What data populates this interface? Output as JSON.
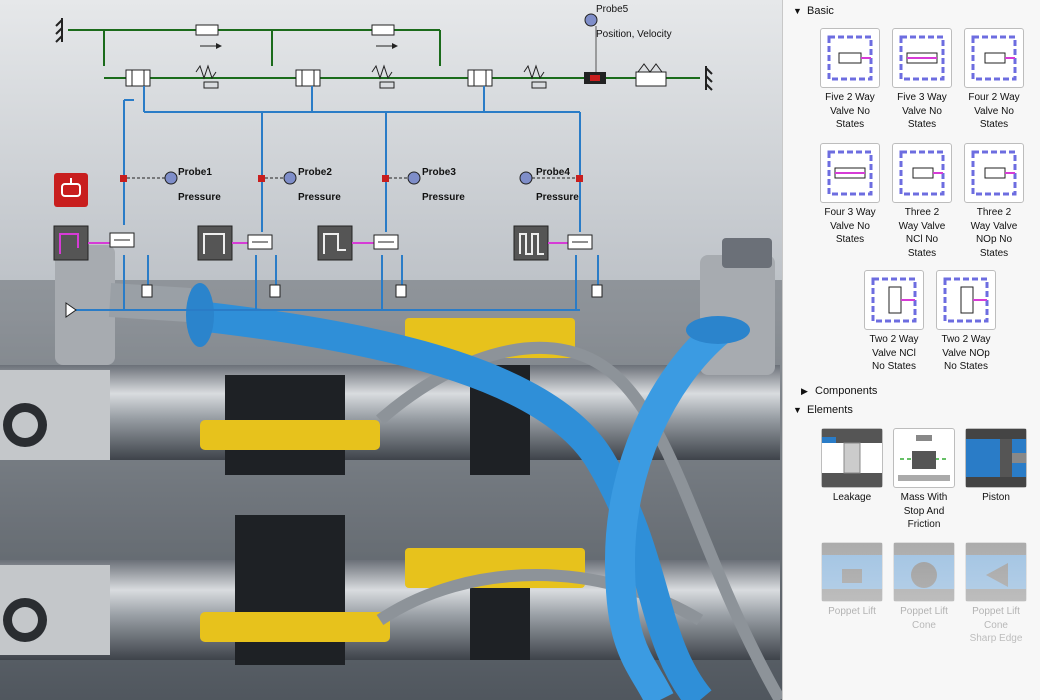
{
  "schematic": {
    "probes": [
      {
        "name": "Probe1",
        "quantity": "Pressure"
      },
      {
        "name": "Probe2",
        "quantity": "Pressure"
      },
      {
        "name": "Probe3",
        "quantity": "Pressure"
      },
      {
        "name": "Probe4",
        "quantity": "Pressure"
      },
      {
        "name": "Probe5",
        "quantity": "Position, Velocity"
      }
    ],
    "colors": {
      "mechanical": "#1b6b1b",
      "hydraulic": "#2a7cc7",
      "signal": "#d63bd6",
      "sensor": "#c81e1e"
    }
  },
  "panel": {
    "basic": {
      "title": "Basic",
      "items": [
        {
          "l1": "Five  2 Way",
          "l2": "Valve No",
          "l3": "States",
          "icon": "five-2-way-valve-icon"
        },
        {
          "l1": "Five  3 Way",
          "l2": "Valve No",
          "l3": "States",
          "icon": "five-3-way-valve-icon"
        },
        {
          "l1": "Four  2 Way",
          "l2": "Valve No",
          "l3": "States",
          "icon": "four-2-way-valve-icon"
        },
        {
          "l1": "Four  3 Way",
          "l2": "Valve No",
          "l3": "States",
          "icon": "four-3-way-valve-icon"
        },
        {
          "l1": "Three  2",
          "l2": "Way Valve",
          "l3": "NCl No",
          "l4": "States",
          "icon": "three-2-way-ncl-icon"
        },
        {
          "l1": "Three  2",
          "l2": "Way Valve",
          "l3": "NOp No",
          "l4": "States",
          "icon": "three-2-way-nop-icon"
        },
        {
          "l1": "Two  2 Way",
          "l2": "Valve NCl",
          "l3": "No States",
          "icon": "two-2-way-ncl-icon"
        },
        {
          "l1": "Two  2 Way",
          "l2": "Valve NOp",
          "l3": "No States",
          "icon": "two-2-way-nop-icon"
        }
      ]
    },
    "components": {
      "title": "Components"
    },
    "elements": {
      "title": "Elements",
      "items": [
        {
          "l1": "Leakage",
          "icon": "leakage-icon"
        },
        {
          "l1": "Mass With",
          "l2": "Stop And",
          "l3": "Friction",
          "icon": "mass-stop-friction-icon"
        },
        {
          "l1": "Piston",
          "icon": "piston-icon"
        },
        {
          "l1": "Poppet Lift",
          "icon": "poppet-lift-icon"
        },
        {
          "l1": "Poppet Lift",
          "l2": "Cone",
          "icon": "poppet-lift-cone-icon"
        },
        {
          "l1": "Poppet Lift",
          "l2": "Cone",
          "l3": "Sharp Edge",
          "icon": "poppet-lift-cone-sharp-edge-icon"
        }
      ]
    }
  }
}
